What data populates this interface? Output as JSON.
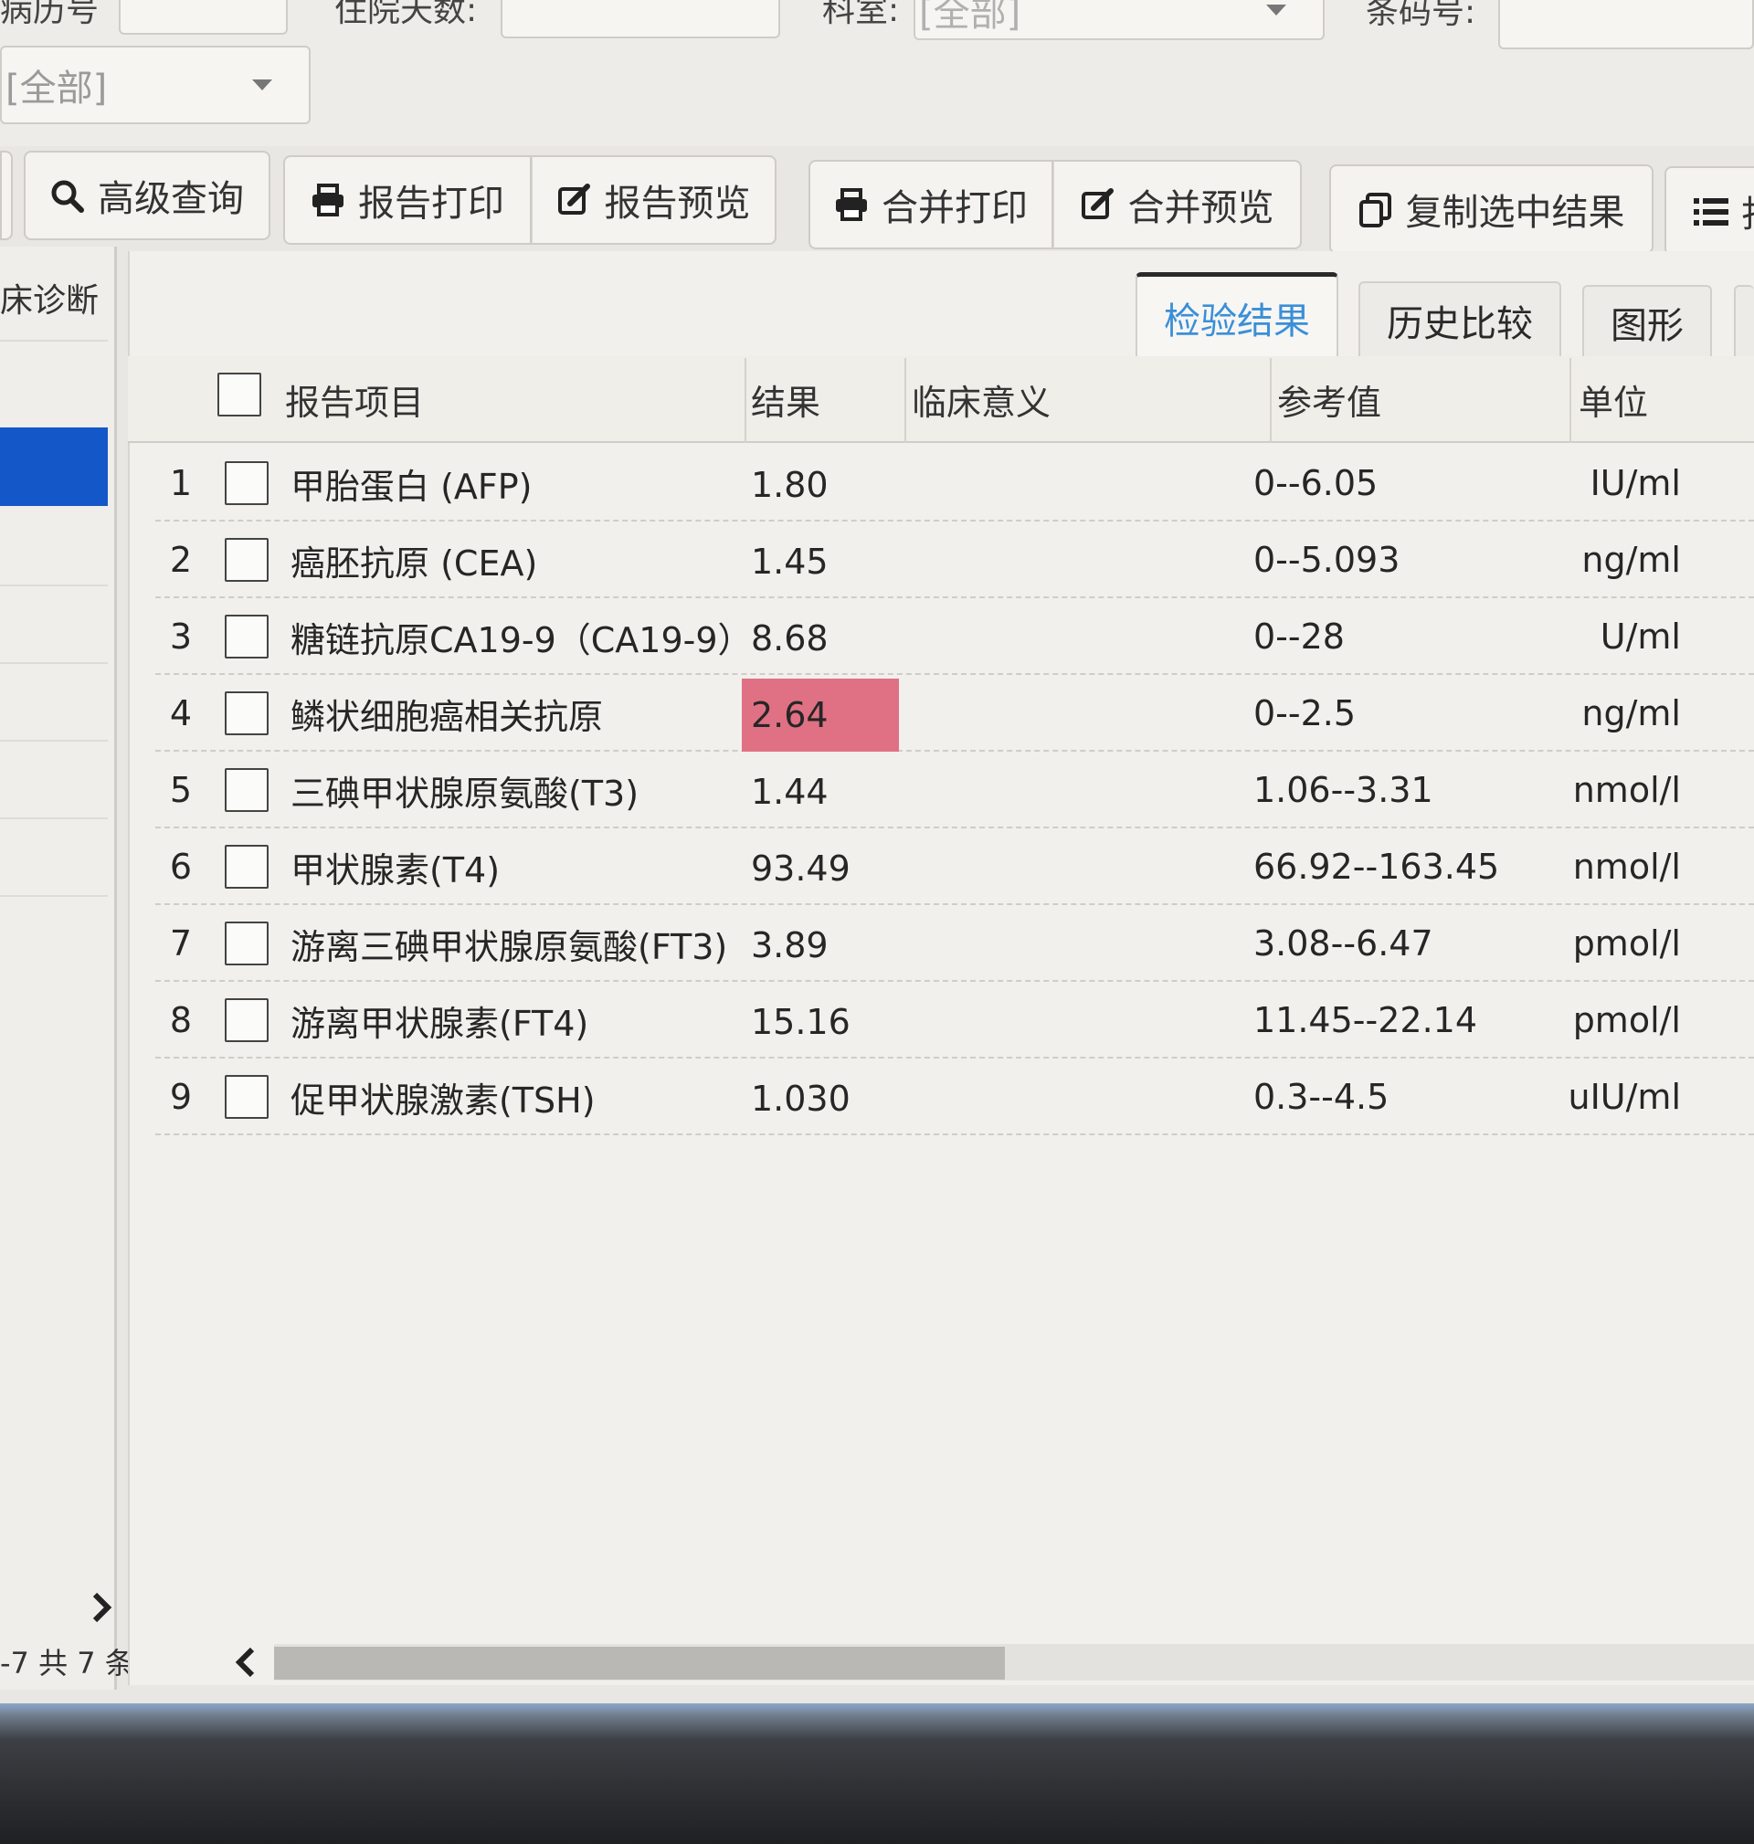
{
  "filters": {
    "row1_labels": [
      "病历号",
      "住院天数:",
      "科室:",
      "条码号:"
    ],
    "dept_select_value": "[全部]",
    "left_select_value": "[全部]"
  },
  "toolbar": {
    "advanced_query": "高级查询",
    "report_print": "报告打印",
    "report_preview": "报告预览",
    "merge_print": "合并打印",
    "merge_preview": "合并预览",
    "copy_selected": "复制选中结果",
    "more_partial": "打"
  },
  "left_panel": {
    "header": "床诊断",
    "pager_text": "-7 共 7 条"
  },
  "tabs": [
    {
      "label": "检验结果",
      "active": true
    },
    {
      "label": "历史比较",
      "active": false
    },
    {
      "label": "图形",
      "active": false
    }
  ],
  "table": {
    "columns": [
      "报告项目",
      "结果",
      "临床意义",
      "参考值",
      "单位"
    ],
    "rows": [
      {
        "num": "1",
        "item": "甲胎蛋白 (AFP)",
        "result": "1.80",
        "ref": "0--6.05",
        "unit": "IU/ml",
        "abnormal": false
      },
      {
        "num": "2",
        "item": "癌胚抗原 (CEA)",
        "result": "1.45",
        "ref": "0--5.093",
        "unit": "ng/ml",
        "abnormal": false
      },
      {
        "num": "3",
        "item": "糖链抗原CA19-9（CA19-9）",
        "result": "8.68",
        "ref": "0--28",
        "unit": "U/ml",
        "abnormal": false
      },
      {
        "num": "4",
        "item": "鳞状细胞癌相关抗原",
        "result": "2.64",
        "ref": "0--2.5",
        "unit": "ng/ml",
        "abnormal": true
      },
      {
        "num": "5",
        "item": "三碘甲状腺原氨酸(T3)",
        "result": "1.44",
        "ref": "1.06--3.31",
        "unit": "nmol/l",
        "abnormal": false
      },
      {
        "num": "6",
        "item": "甲状腺素(T4)",
        "result": "93.49",
        "ref": "66.92--163.45",
        "unit": "nmol/l",
        "abnormal": false
      },
      {
        "num": "7",
        "item": "游离三碘甲状腺原氨酸(FT3)",
        "result": "3.89",
        "ref": "3.08--6.47",
        "unit": "pmol/l",
        "abnormal": false
      },
      {
        "num": "8",
        "item": "游离甲状腺素(FT4)",
        "result": "15.16",
        "ref": "11.45--22.14",
        "unit": "pmol/l",
        "abnormal": false
      },
      {
        "num": "9",
        "item": "促甲状腺激素(TSH)",
        "result": "1.030",
        "ref": "0.3--4.5",
        "unit": "uIU/ml",
        "abnormal": false
      }
    ]
  },
  "colors": {
    "abnormal_highlight": "#e07184",
    "active_tab_text": "#3b8fd8",
    "left_selection": "#1457c9"
  }
}
